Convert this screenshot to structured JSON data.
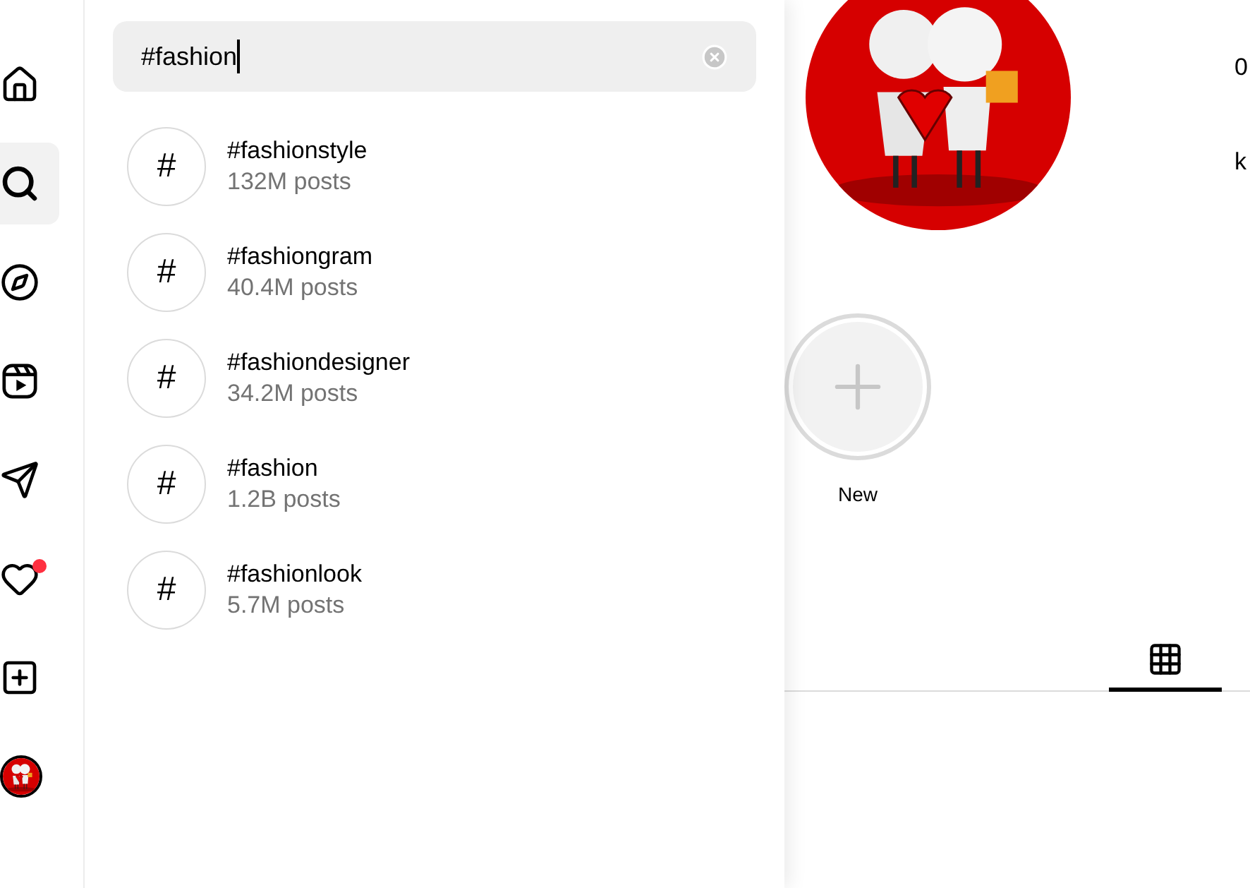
{
  "nav": [
    {
      "kind": "home",
      "selected": false,
      "notification": false
    },
    {
      "kind": "search",
      "selected": true,
      "notification": false
    },
    {
      "kind": "explore",
      "selected": false,
      "notification": false
    },
    {
      "kind": "reels",
      "selected": false,
      "notification": false
    },
    {
      "kind": "messages",
      "selected": false,
      "notification": false
    },
    {
      "kind": "notifications",
      "selected": false,
      "notification": true
    },
    {
      "kind": "create",
      "selected": false,
      "notification": false
    },
    {
      "kind": "profile",
      "selected": false,
      "notification": false
    }
  ],
  "search": {
    "value": "#fashion"
  },
  "results": [
    {
      "icon": "#",
      "tag": "#fashionstyle",
      "posts": "132M posts"
    },
    {
      "icon": "#",
      "tag": "#fashiongram",
      "posts": "40.4M posts"
    },
    {
      "icon": "#",
      "tag": "#fashiondesigner",
      "posts": "34.2M posts"
    },
    {
      "icon": "#",
      "tag": "#fashion",
      "posts": "1.2B posts"
    },
    {
      "icon": "#",
      "tag": "#fashionlook",
      "posts": "5.7M posts"
    }
  ],
  "profile": {
    "stat_1": "0",
    "stat_2": "k"
  },
  "highlights": [
    {
      "label": "New"
    }
  ],
  "tabs": [
    {
      "kind": "grid",
      "selected": true
    }
  ]
}
